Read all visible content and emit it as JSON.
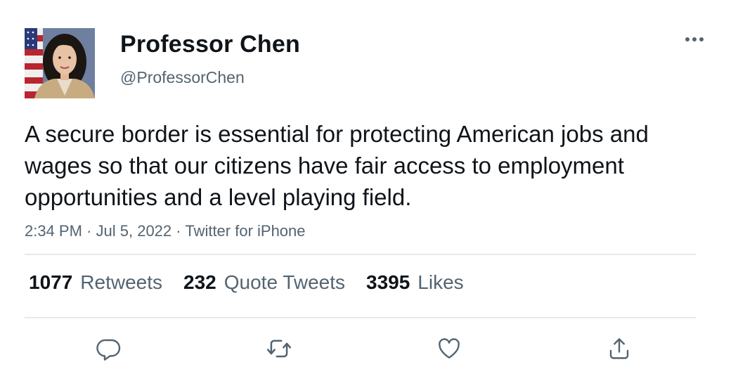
{
  "author": {
    "display_name": "Professor Chen",
    "handle": "@ProfessorChen",
    "avatar_icon": "profile-photo"
  },
  "tweet": {
    "text": "A secure border is essential for protecting American jobs and wages so that our citizens have fair access to employment opportunities and a level playing field.",
    "time": "2:34 PM",
    "separator": "·",
    "date": "Jul 5, 2022",
    "source": "Twitter for iPhone"
  },
  "stats": {
    "retweets": {
      "count": "1077",
      "label": "Retweets"
    },
    "quote_tweets": {
      "count": "232",
      "label": "Quote Tweets"
    },
    "likes": {
      "count": "3395",
      "label": "Likes"
    }
  },
  "actions": {
    "reply_icon": "reply-icon",
    "retweet_icon": "retweet-icon",
    "like_icon": "heart-icon",
    "share_icon": "share-icon"
  },
  "colors": {
    "text_primary": "#0f1419",
    "text_secondary": "#536471",
    "divider": "#e6e9ec",
    "icon": "#536471"
  }
}
